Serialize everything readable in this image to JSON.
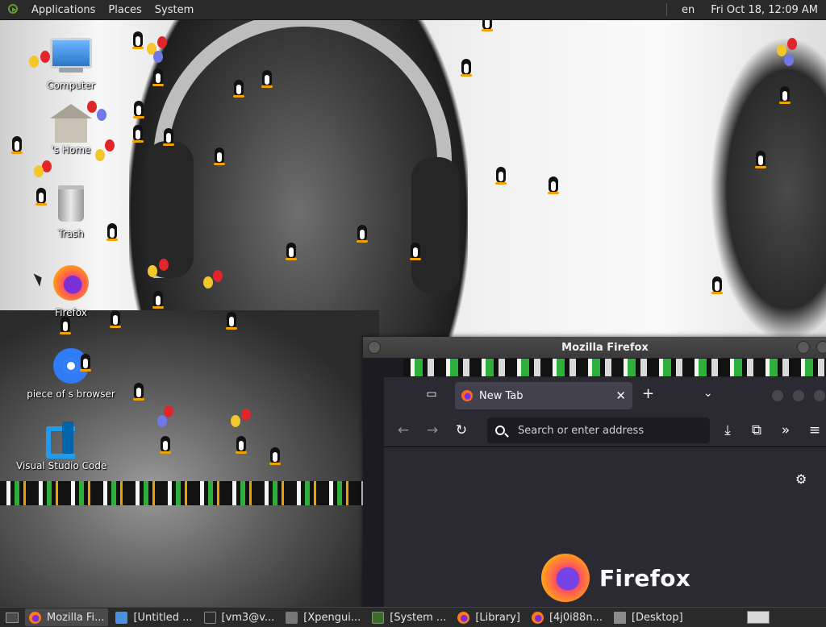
{
  "top_panel": {
    "menus": [
      "Applications",
      "Places",
      "System"
    ],
    "keyboard_layout": "en",
    "clock": "Fri Oct 18, 12:09 AM"
  },
  "desktop": {
    "icons": [
      {
        "label": "Computer",
        "icon": "computer-icon"
      },
      {
        "label": "'s Home",
        "icon": "home-folder-icon"
      },
      {
        "label": "Trash",
        "icon": "trash-icon"
      },
      {
        "label": "Firefox",
        "icon": "firefox-icon"
      },
      {
        "label": "piece of s browser",
        "icon": "chromium-icon"
      },
      {
        "label": "Visual Studio Code",
        "icon": "vscode-icon"
      }
    ]
  },
  "firefox_window": {
    "title": "Mozilla Firefox",
    "tab": {
      "label": "New Tab",
      "favicon": "firefox-favicon-icon"
    },
    "new_tab_symbol": "+",
    "url_placeholder": "Search or enter address",
    "brand": "Firefox"
  },
  "taskbar": {
    "tasks": [
      {
        "label": "Mozilla Fi...",
        "icon": "firefox-icon",
        "active": true
      },
      {
        "label": "[Untitled ...",
        "icon": "document-icon",
        "active": false
      },
      {
        "label": "[vm3@v...",
        "icon": "terminal-icon",
        "active": false
      },
      {
        "label": "[Xpengui...",
        "icon": "window-icon",
        "active": false
      },
      {
        "label": "[System ...",
        "icon": "system-monitor-icon",
        "active": false
      },
      {
        "label": "[Library]",
        "icon": "firefox-icon",
        "active": false
      },
      {
        "label": "[4j0i88n...",
        "icon": "firefox-icon",
        "active": false
      },
      {
        "label": "[Desktop]",
        "icon": "folder-icon",
        "active": false
      }
    ]
  },
  "colors": {
    "panel_bg": "#2a2a2a",
    "firefox_toolbar": "#2b2a33",
    "firefox_tab_active": "#42414d",
    "firefox_content": "#2b2a33"
  }
}
